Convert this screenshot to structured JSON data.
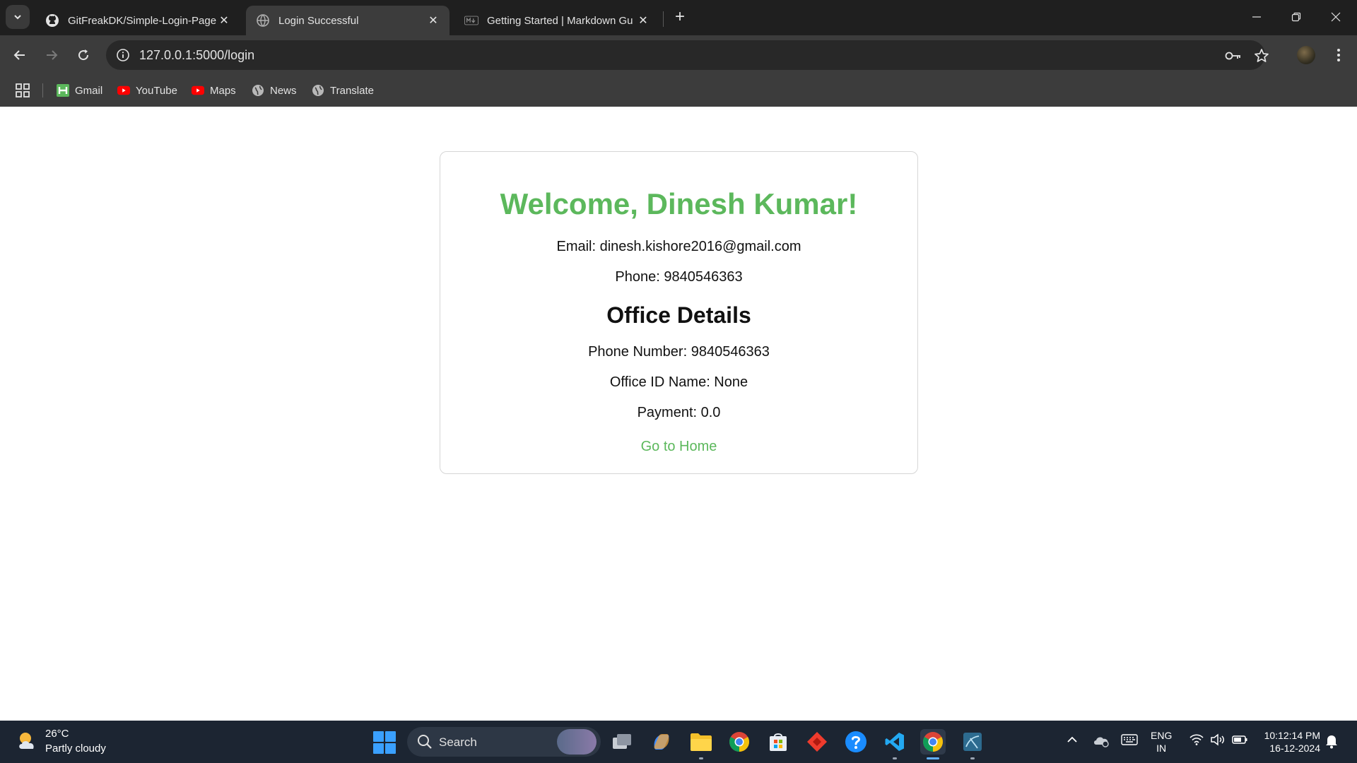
{
  "browser": {
    "tabs": [
      {
        "title": "GitFreakDK/Simple-Login-Page",
        "favicon": "github-icon",
        "active": false
      },
      {
        "title": "Login Successful",
        "favicon": "globe-icon",
        "active": true
      },
      {
        "title": "Getting Started | Markdown Gu",
        "favicon": "markdown-icon",
        "active": false
      }
    ],
    "new_tab_label": "+",
    "url": "127.0.0.1:5000/login"
  },
  "bookmarks": [
    {
      "label": "Gmail",
      "icon": "gmail-icon"
    },
    {
      "label": "YouTube",
      "icon": "youtube-icon"
    },
    {
      "label": "Maps",
      "icon": "maps-icon"
    },
    {
      "label": "News",
      "icon": "globe-icon"
    },
    {
      "label": "Translate",
      "icon": "globe-icon"
    }
  ],
  "page": {
    "welcome": "Welcome, Dinesh Kumar!",
    "email_line": "Email: dinesh.kishore2016@gmail.com",
    "phone_line": "Phone: 9840546363",
    "office_title": "Office Details",
    "office_phone_line": "Phone Number: 9840546363",
    "office_id_line": "Office ID Name: None",
    "payment_line": "Payment: 0.0",
    "home_link": "Go to Home"
  },
  "taskbar": {
    "weather_temp": "26°C",
    "weather_desc": "Partly cloudy",
    "search_label": "Search",
    "lang_top": "ENG",
    "lang_bottom": "IN",
    "time": "10:12:14 PM",
    "date": "16-12-2024"
  },
  "colors": {
    "accent_green": "#5cb85c",
    "chrome_dark": "#1f1f1f",
    "chrome_toolbar": "#3c3c3c",
    "taskbar": "#1c2532"
  }
}
